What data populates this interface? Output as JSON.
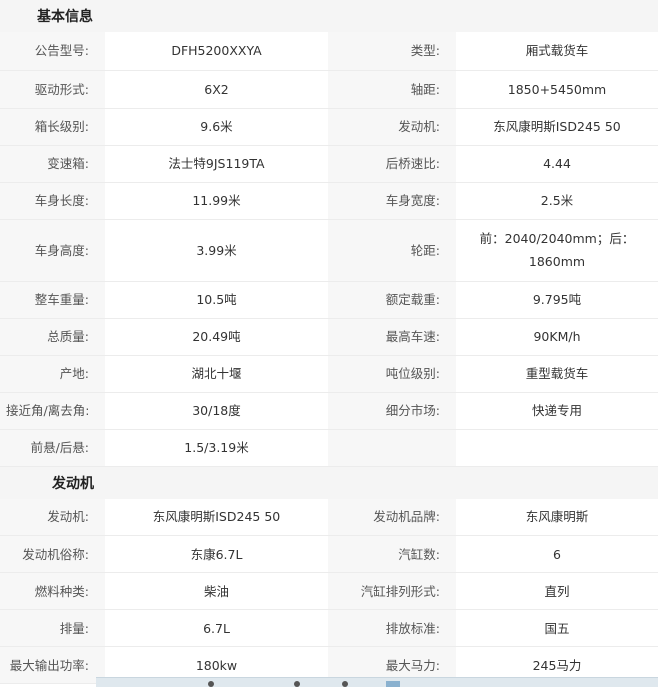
{
  "basic": {
    "title": "基本信息",
    "rows": [
      [
        "公告型号:",
        "DFH5200XXYA",
        "类型:",
        "厢式载货车"
      ],
      [
        "驱动形式:",
        "6X2",
        "轴距:",
        "1850+5450mm"
      ],
      [
        "箱长级别:",
        "9.6米",
        "发动机:",
        "东风康明斯ISD245 50"
      ],
      [
        "变速箱:",
        "法士特9JS119TA",
        "后桥速比:",
        "4.44"
      ],
      [
        "车身长度:",
        "11.99米",
        "车身宽度:",
        "2.5米"
      ],
      [
        "车身高度:",
        "3.99米",
        "轮距:",
        "前：2040/2040mm；后：1860mm"
      ],
      [
        "整车重量:",
        "10.5吨",
        "额定载重:",
        "9.795吨"
      ],
      [
        "总质量:",
        "20.49吨",
        "最高车速:",
        "90KM/h"
      ],
      [
        "产地:",
        "湖北十堰",
        "吨位级别:",
        "重型载货车"
      ],
      [
        "接近角/离去角:",
        "30/18度",
        "细分市场:",
        "快递专用"
      ],
      [
        "前悬/后悬:",
        "1.5/3.19米",
        "",
        ""
      ]
    ]
  },
  "engine": {
    "title": "发动机",
    "rows": [
      [
        "发动机:",
        "东风康明斯ISD245 50",
        "发动机品牌:",
        "东风康明斯"
      ],
      [
        "发动机俗称:",
        "东康6.7L",
        "汽缸数:",
        "6"
      ],
      [
        "燃料种类:",
        "柴油",
        "汽缸排列形式:",
        "直列"
      ],
      [
        "排量:",
        "6.7L",
        "排放标准:",
        "国五"
      ],
      [
        "最大输出功率:",
        "180kw",
        "最大马力:",
        "245马力"
      ]
    ]
  }
}
